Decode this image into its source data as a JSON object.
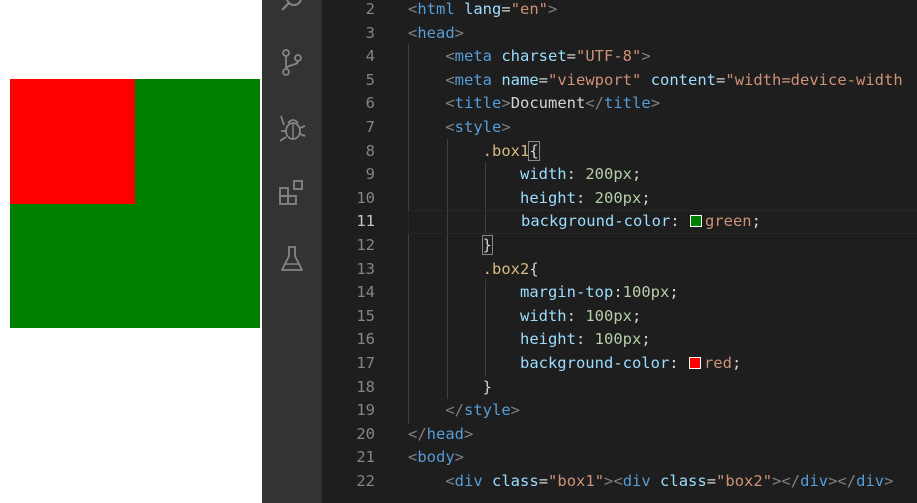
{
  "preview": {
    "outer_color": "#008000",
    "inner_color": "#ff0000"
  },
  "activity_bar": {
    "icons": [
      "search-icon",
      "source-control-icon",
      "debug-icon",
      "extensions-icon",
      "testing-icon"
    ]
  },
  "editor": {
    "colors": {
      "background": "#1e1e1e",
      "tag": "#569cd6",
      "attribute": "#9cdcfe",
      "string": "#ce9178",
      "selector": "#d7ba7d",
      "number": "#b5cea8"
    },
    "lines": [
      {
        "num": "2",
        "tokens": [
          [
            "t-punc",
            "<"
          ],
          [
            "t-tag",
            "html"
          ],
          [
            "t-plain",
            " "
          ],
          [
            "t-attr",
            "lang"
          ],
          [
            "t-plain",
            "="
          ],
          [
            "t-str",
            "\"en\""
          ],
          [
            "t-punc",
            ">"
          ]
        ]
      },
      {
        "num": "3",
        "tokens": [
          [
            "t-punc",
            "<"
          ],
          [
            "t-tag",
            "head"
          ],
          [
            "t-punc",
            ">"
          ]
        ]
      },
      {
        "num": "4",
        "tokens": [
          [
            "t-plain",
            "    "
          ],
          [
            "t-punc",
            "<"
          ],
          [
            "t-tag",
            "meta"
          ],
          [
            "t-plain",
            " "
          ],
          [
            "t-attr",
            "charset"
          ],
          [
            "t-plain",
            "="
          ],
          [
            "t-str",
            "\"UTF-8\""
          ],
          [
            "t-punc",
            ">"
          ]
        ]
      },
      {
        "num": "5",
        "tokens": [
          [
            "t-plain",
            "    "
          ],
          [
            "t-punc",
            "<"
          ],
          [
            "t-tag",
            "meta"
          ],
          [
            "t-plain",
            " "
          ],
          [
            "t-attr",
            "name"
          ],
          [
            "t-plain",
            "="
          ],
          [
            "t-str",
            "\"viewport\""
          ],
          [
            "t-plain",
            " "
          ],
          [
            "t-attr",
            "content"
          ],
          [
            "t-plain",
            "="
          ],
          [
            "t-str",
            "\"width=device-width"
          ]
        ]
      },
      {
        "num": "6",
        "tokens": [
          [
            "t-plain",
            "    "
          ],
          [
            "t-punc",
            "<"
          ],
          [
            "t-tag",
            "title"
          ],
          [
            "t-punc",
            ">"
          ],
          [
            "t-plain",
            "Document"
          ],
          [
            "t-punc",
            "</"
          ],
          [
            "t-tag",
            "title"
          ],
          [
            "t-punc",
            ">"
          ]
        ]
      },
      {
        "num": "7",
        "tokens": [
          [
            "t-plain",
            "    "
          ],
          [
            "t-punc",
            "<"
          ],
          [
            "t-tag",
            "style"
          ],
          [
            "t-punc",
            ">"
          ]
        ]
      },
      {
        "num": "8",
        "tokens": [
          [
            "t-plain",
            "        "
          ],
          [
            "t-sel",
            ".box1"
          ],
          [
            "t-brace-m",
            "{"
          ]
        ]
      },
      {
        "num": "9",
        "tokens": [
          [
            "t-plain",
            "            "
          ],
          [
            "t-prop",
            "width"
          ],
          [
            "t-plain",
            ": "
          ],
          [
            "t-num",
            "200px"
          ],
          [
            "t-plain",
            ";"
          ]
        ]
      },
      {
        "num": "10",
        "tokens": [
          [
            "t-plain",
            "            "
          ],
          [
            "t-prop",
            "height"
          ],
          [
            "t-plain",
            ": "
          ],
          [
            "t-num",
            "200px"
          ],
          [
            "t-plain",
            ";"
          ]
        ]
      },
      {
        "num": "11",
        "current": true,
        "tokens": [
          [
            "t-plain",
            "            "
          ],
          [
            "t-prop",
            "background-color"
          ],
          [
            "t-plain",
            ": "
          ],
          [
            "swatch",
            "#008000"
          ],
          [
            "t-val",
            "green"
          ],
          [
            "t-plain",
            ";"
          ]
        ]
      },
      {
        "num": "12",
        "tokens": [
          [
            "t-plain",
            "        "
          ],
          [
            "t-brace-m",
            "}"
          ]
        ]
      },
      {
        "num": "13",
        "tokens": [
          [
            "t-plain",
            "        "
          ],
          [
            "t-sel",
            ".box2"
          ],
          [
            "t-plain",
            "{"
          ]
        ]
      },
      {
        "num": "14",
        "tokens": [
          [
            "t-plain",
            "            "
          ],
          [
            "t-prop",
            "margin-top"
          ],
          [
            "t-plain",
            ":"
          ],
          [
            "t-num",
            "100px"
          ],
          [
            "t-plain",
            ";"
          ]
        ]
      },
      {
        "num": "15",
        "tokens": [
          [
            "t-plain",
            "            "
          ],
          [
            "t-prop",
            "width"
          ],
          [
            "t-plain",
            ": "
          ],
          [
            "t-num",
            "100px"
          ],
          [
            "t-plain",
            ";"
          ]
        ]
      },
      {
        "num": "16",
        "tokens": [
          [
            "t-plain",
            "            "
          ],
          [
            "t-prop",
            "height"
          ],
          [
            "t-plain",
            ": "
          ],
          [
            "t-num",
            "100px"
          ],
          [
            "t-plain",
            ";"
          ]
        ]
      },
      {
        "num": "17",
        "tokens": [
          [
            "t-plain",
            "            "
          ],
          [
            "t-prop",
            "background-color"
          ],
          [
            "t-plain",
            ": "
          ],
          [
            "swatch",
            "#ff0000"
          ],
          [
            "t-val",
            "red"
          ],
          [
            "t-plain",
            ";"
          ]
        ]
      },
      {
        "num": "18",
        "tokens": [
          [
            "t-plain",
            "        "
          ],
          [
            "t-plain",
            "}"
          ]
        ]
      },
      {
        "num": "19",
        "tokens": [
          [
            "t-plain",
            "    "
          ],
          [
            "t-punc",
            "</"
          ],
          [
            "t-tag",
            "style"
          ],
          [
            "t-punc",
            ">"
          ]
        ]
      },
      {
        "num": "20",
        "tokens": [
          [
            "t-punc",
            "</"
          ],
          [
            "t-tag",
            "head"
          ],
          [
            "t-punc",
            ">"
          ]
        ]
      },
      {
        "num": "21",
        "tokens": [
          [
            "t-punc",
            "<"
          ],
          [
            "t-tag",
            "body"
          ],
          [
            "t-punc",
            ">"
          ]
        ]
      },
      {
        "num": "22",
        "tokens": [
          [
            "t-plain",
            "    "
          ],
          [
            "t-punc",
            "<"
          ],
          [
            "t-tag",
            "div"
          ],
          [
            "t-plain",
            " "
          ],
          [
            "t-attr",
            "class"
          ],
          [
            "t-plain",
            "="
          ],
          [
            "t-str",
            "\"box1\""
          ],
          [
            "t-punc",
            "><"
          ],
          [
            "t-tag",
            "div"
          ],
          [
            "t-plain",
            " "
          ],
          [
            "t-attr",
            "class"
          ],
          [
            "t-plain",
            "="
          ],
          [
            "t-str",
            "\"box2\""
          ],
          [
            "t-punc",
            "></"
          ],
          [
            "t-tag",
            "div"
          ],
          [
            "t-punc",
            "></"
          ],
          [
            "t-tag",
            "div"
          ],
          [
            "t-punc",
            ">"
          ]
        ]
      }
    ]
  }
}
